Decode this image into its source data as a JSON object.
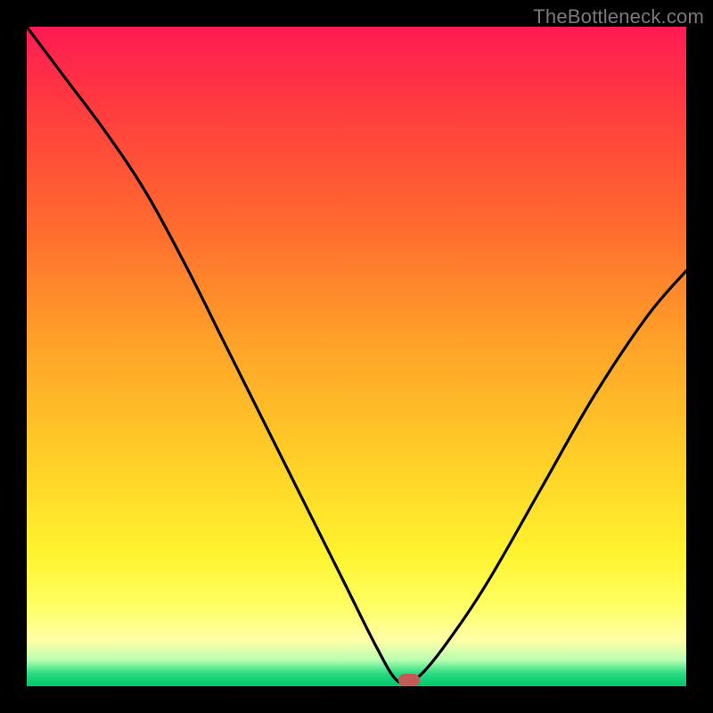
{
  "watermark": "TheBottleneck.com",
  "colors": {
    "frame": "#000000",
    "curve": "#000000",
    "marker": "#c45a55",
    "gradient_top": "#ff1a52",
    "gradient_bottom": "#00c46a"
  },
  "chart_data": {
    "type": "line",
    "title": "",
    "xlabel": "",
    "ylabel": "",
    "xlim": [
      0,
      100
    ],
    "ylim": [
      0,
      100
    ],
    "grid": false,
    "legend": false,
    "annotations": [
      {
        "name": "minimum-marker",
        "x": 58,
        "y": 1
      }
    ],
    "series": [
      {
        "name": "bottleneck-curve",
        "x": [
          0,
          6,
          12,
          18,
          24,
          30,
          36,
          42,
          48,
          53,
          56,
          58,
          60,
          64,
          70,
          78,
          86,
          94,
          100
        ],
        "values": [
          100,
          92,
          84,
          75,
          64,
          52,
          40,
          28,
          16,
          6,
          1,
          1,
          2,
          7,
          16,
          30,
          44,
          56,
          63
        ]
      }
    ]
  }
}
